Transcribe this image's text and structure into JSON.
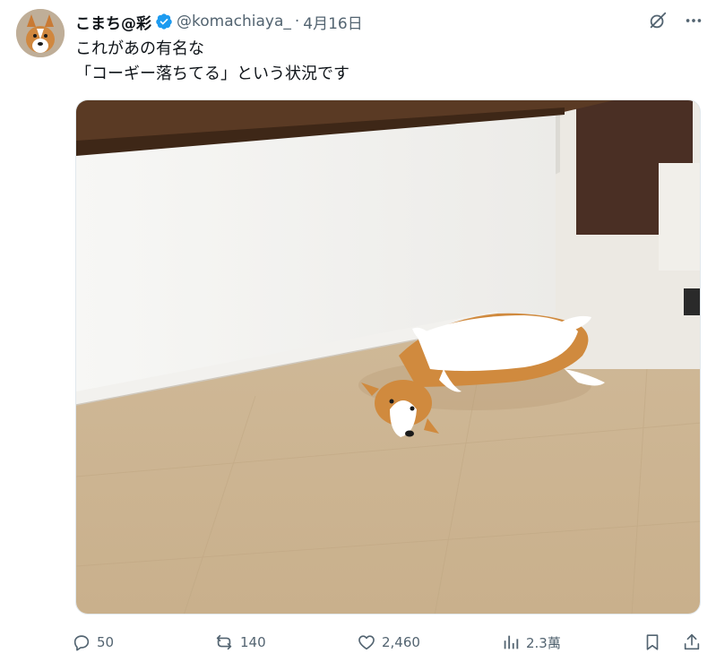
{
  "post": {
    "author": {
      "display_name": "こまち@彩",
      "handle": "@komachiaya_",
      "verified": true
    },
    "separator": "·",
    "date": "4月16日",
    "text": "これがあの有名な\n「コーギー落ちてる」という状況です",
    "media": {
      "description_icon": "photo-corgi-lying-on-floor"
    }
  },
  "top_icons": [
    "grok-icon",
    "more-icon"
  ],
  "actions": {
    "replies": "50",
    "reposts": "140",
    "likes": "2,460",
    "views": "2.3萬"
  },
  "colors": {
    "text": "#0f1419",
    "secondary": "#536471",
    "verified": "#1d9bf0"
  }
}
